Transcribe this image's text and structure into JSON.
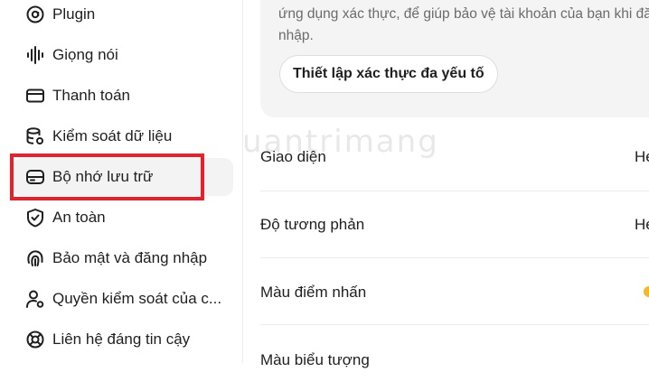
{
  "sidebar": {
    "items": [
      {
        "label": "Plugin",
        "icon": "plugin-icon"
      },
      {
        "label": "Giọng nói",
        "icon": "voice-waveform-icon"
      },
      {
        "label": "Thanh toán",
        "icon": "credit-card-icon"
      },
      {
        "label": "Kiểm soát dữ liệu",
        "icon": "database-settings-icon"
      },
      {
        "label": "Bộ nhớ lưu trữ",
        "icon": "storage-drive-icon"
      },
      {
        "label": "An toàn",
        "icon": "shield-check-icon"
      },
      {
        "label": "Bảo mật và đăng nhập",
        "icon": "fingerprint-icon"
      },
      {
        "label": "Quyền kiểm soát của c...",
        "icon": "user-settings-icon"
      },
      {
        "label": "Liên hệ đáng tin cậy",
        "icon": "lifebuoy-icon"
      }
    ],
    "active_index": 4,
    "highlight_color": "#e8202a"
  },
  "mfa": {
    "text": "ứng dụng xác thực, để giúp bảo vệ tài khoản của bạn khi đăng nhập.",
    "button_label": "Thiết lập xác thực đa yếu tố"
  },
  "settings": {
    "rows": [
      {
        "label": "Giao diện",
        "value": "He"
      },
      {
        "label": "Độ tương phản",
        "value": "He"
      },
      {
        "label": "Màu điểm nhấn",
        "value": ""
      },
      {
        "label": "Màu biểu tượng",
        "value": ""
      }
    ],
    "accent_color": "#f2b731"
  },
  "watermark": "uantrimang"
}
